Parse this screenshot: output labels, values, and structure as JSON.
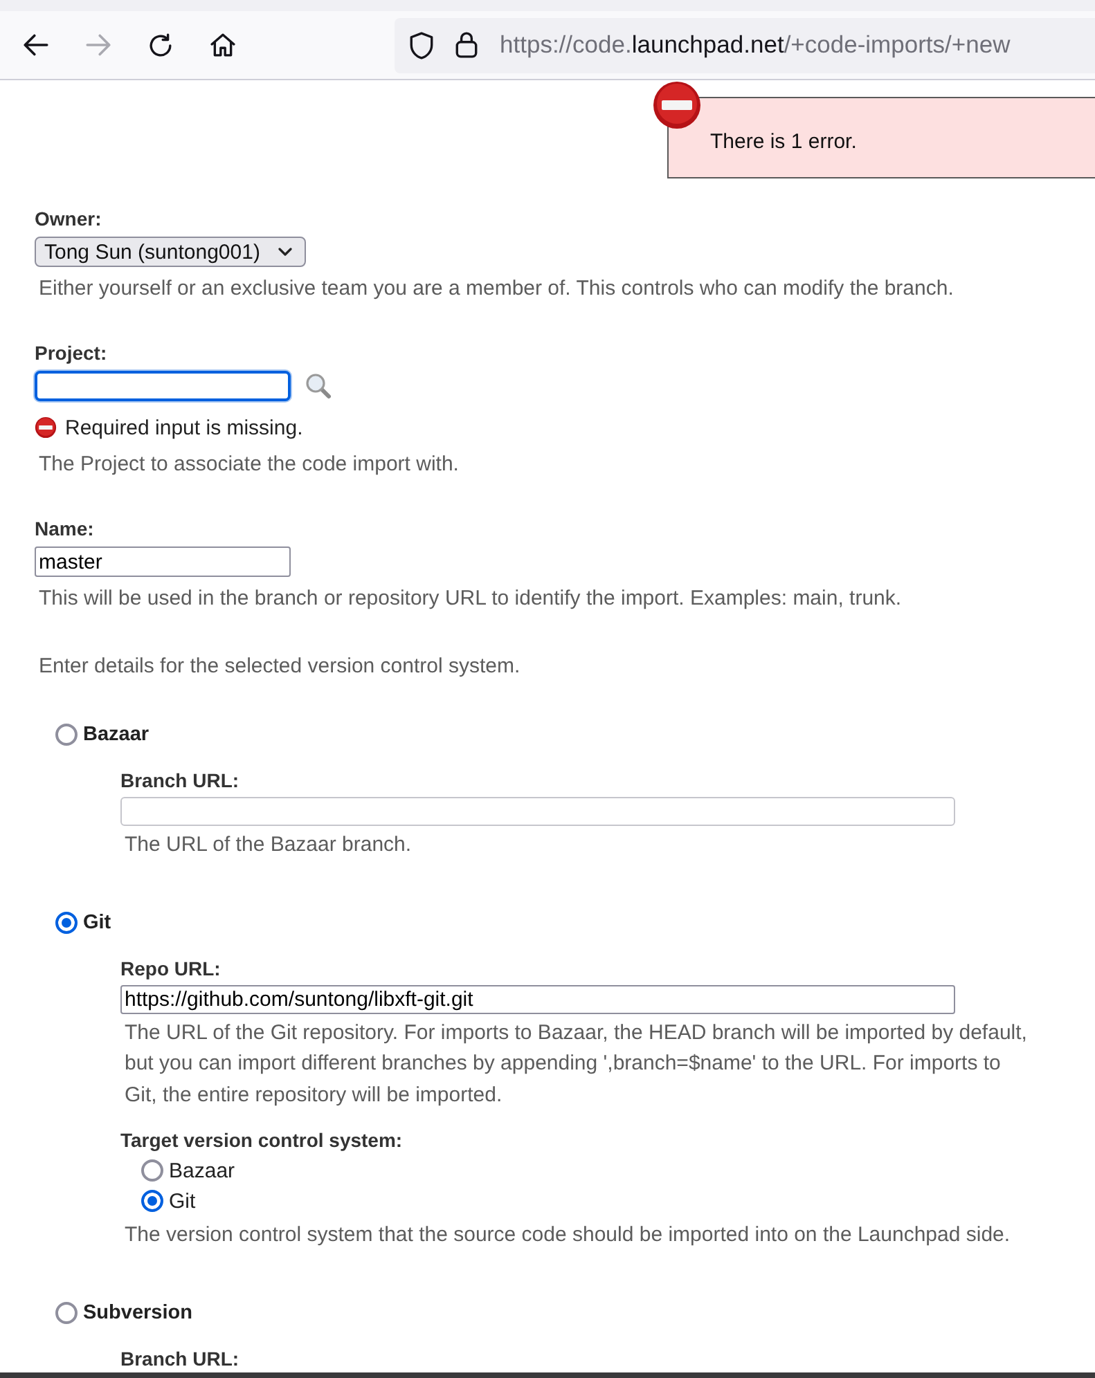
{
  "browser": {
    "nav_buttons": [
      {
        "kind": "back",
        "disabled": false
      },
      {
        "kind": "forward",
        "disabled": true
      },
      {
        "kind": "reload",
        "disabled": false
      },
      {
        "kind": "home",
        "disabled": false
      }
    ],
    "url": {
      "prefix": "https://code.",
      "domain": "launchpad.net",
      "path": "/+code-imports/+new"
    }
  },
  "error_banner": {
    "message": "There is 1 error."
  },
  "fields": [
    {
      "kind": "select",
      "label": "Owner:",
      "value": "Tong Sun (suntong001)",
      "focused": false,
      "help": "Either yourself or an exclusive team you are a member of. This controls who can modify the branch."
    },
    {
      "kind": "lookup",
      "label": "Project:",
      "focused": true,
      "error": "Required input is missing.",
      "help": "The Project to associate the code import with."
    },
    {
      "kind": "text",
      "label": "Name:",
      "value": "master",
      "focused": false,
      "help": "This will be used in the branch or repository URL to identify the import. Examples: main, trunk."
    }
  ],
  "vcs_intro": "Enter details for the selected version control system.",
  "vcs_options": [
    {
      "label": "Bazaar",
      "selected": false,
      "fields": [
        {
          "kind": "text",
          "label": "Branch URL:",
          "disabled": true,
          "help": "The URL of the Bazaar branch."
        }
      ]
    },
    {
      "label": "Git",
      "selected": true,
      "fields": [
        {
          "kind": "text",
          "label": "Repo URL:",
          "value": "https://github.com/suntong/libxft-git.git",
          "disabled": false,
          "help": "The URL of the Git repository. For imports to Bazaar, the HEAD branch will be imported by default, but you can import different branches by appending ',branch=$name' to the URL. For imports to Git, the entire repository will be imported."
        },
        {
          "kind": "radio_group",
          "label": "Target version control system:",
          "options": [
            {
              "label": "Bazaar",
              "selected": false
            },
            {
              "label": "Git",
              "selected": true
            }
          ],
          "help": "The version control system that the source code should be imported into on the Launchpad side."
        }
      ]
    },
    {
      "label": "Subversion",
      "selected": false,
      "fields": [
        {
          "kind": "label",
          "label": "Branch URL:"
        }
      ]
    }
  ]
}
